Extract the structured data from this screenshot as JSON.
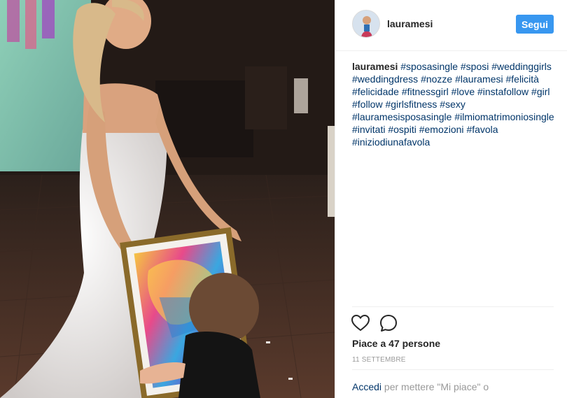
{
  "post": {
    "username": "lauramesi",
    "follow_label": "Segui"
  },
  "caption": {
    "username": "lauramesi",
    "hashtags": [
      "#sposasingle",
      "#sposi",
      "#weddinggirls",
      "#weddingdress",
      "#nozze",
      "#lauramesi",
      "#felicità",
      "#felicidade",
      "#fitnessgirl",
      "#love",
      "#instafollow",
      "#girl",
      "#follow",
      "#girlsfitness",
      "#sexy",
      "#lauramesisposasingle",
      "#ilmiomatrimoniosingle",
      "#invitati",
      "#ospiti",
      "#emozioni",
      "#favola",
      "#iniziodiunafavola"
    ]
  },
  "actions": {
    "like_icon": "heart-outline-icon",
    "comment_icon": "comment-bubble-icon"
  },
  "likes_text": "Piace a 47 persone",
  "date_text": "11 SETTEMBRE",
  "login": {
    "link_text": "Accedi",
    "rest_text": " per mettere \"Mi piace\" o"
  },
  "colors": {
    "follow_button": "#3897f0",
    "hashtag": "#003569",
    "muted": "#999999"
  }
}
